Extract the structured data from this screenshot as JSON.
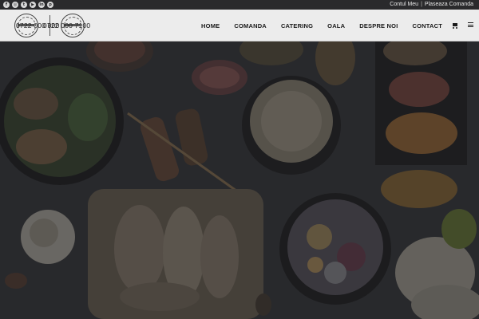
{
  "topbar": {
    "socials": [
      {
        "icon": "facebook-icon",
        "glyph": "f"
      },
      {
        "icon": "instagram-icon",
        "glyph": "◎"
      },
      {
        "icon": "twitter-icon",
        "glyph": "t"
      },
      {
        "icon": "youtube-icon",
        "glyph": "▶"
      },
      {
        "icon": "linkedin-icon",
        "glyph": "in"
      },
      {
        "icon": "pinterest-icon",
        "glyph": "p"
      }
    ],
    "account_link": "Contul Meu",
    "separator": "|",
    "order_link": "Plaseaza Comanda"
  },
  "header": {
    "phone_1": "0722 000 000",
    "phone_2": "0722 000 7100",
    "nav": [
      {
        "label": "HOME"
      },
      {
        "label": "COMANDA"
      },
      {
        "label": "CATERING"
      },
      {
        "label": "OALA"
      },
      {
        "label": "DESPRE NOI"
      },
      {
        "label": "CONTACT"
      }
    ],
    "cart_icon": "cart-icon",
    "menu_icon": "hamburger-menu-icon"
  },
  "hero": {
    "background": "dark-food-photo",
    "colors": {
      "overlay": "#1a1a1c",
      "table": "#3a3b3e"
    }
  }
}
